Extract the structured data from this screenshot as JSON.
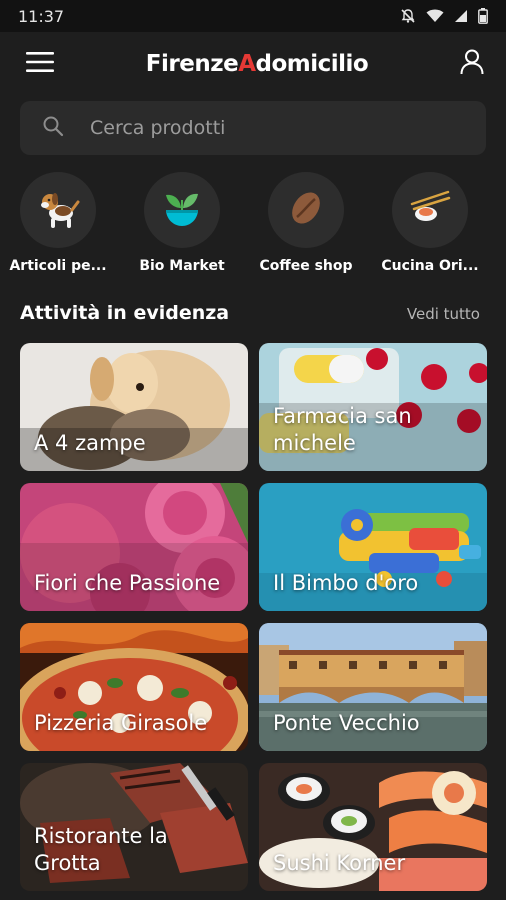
{
  "status_bar": {
    "time": "11:37",
    "icons": [
      "notifications-off-icon",
      "wifi-icon",
      "signal-icon",
      "battery-icon"
    ]
  },
  "app_bar": {
    "menu_icon": "hamburger-menu-icon",
    "logo": {
      "part1": "Firenze",
      "accent": "A",
      "part2": "domicilio"
    },
    "profile_icon": "user-profile-icon"
  },
  "search": {
    "icon": "search-icon",
    "placeholder": "Cerca prodotti"
  },
  "categories": [
    {
      "label": "Articoli pe...",
      "icon": "dog-icon"
    },
    {
      "label": "Bio Market",
      "icon": "sprout-bowl-icon"
    },
    {
      "label": "Coffee shop",
      "icon": "coffee-bean-icon"
    },
    {
      "label": "Cucina Ori...",
      "icon": "sushi-chopsticks-icon"
    }
  ],
  "featured": {
    "title": "Attività in evidenza",
    "see_all": "Vedi tutto",
    "items": [
      {
        "name": "A 4 zampe",
        "image": "puppy-and-kitten-photo"
      },
      {
        "name": "Farmacia san michele",
        "image": "pills-photo"
      },
      {
        "name": "Fiori che Passione",
        "image": "pink-roses-photo"
      },
      {
        "name": "Il Bimbo d'oro",
        "image": "toy-airplane-photo"
      },
      {
        "name": "Pizzeria Girasole",
        "image": "pizza-photo"
      },
      {
        "name": "Ponte Vecchio",
        "image": "ponte-vecchio-bridge-photo"
      },
      {
        "name": "Ristorante la Grotta",
        "image": "grilled-steak-photo"
      },
      {
        "name": "Sushi Korner",
        "image": "sushi-platter-photo"
      }
    ]
  },
  "colors": {
    "background": "#1e1e1e",
    "status_bar": "#121212",
    "surface": "#2b2b2b",
    "logo_accent": "#e53935",
    "muted_text": "#b5b5b5"
  }
}
